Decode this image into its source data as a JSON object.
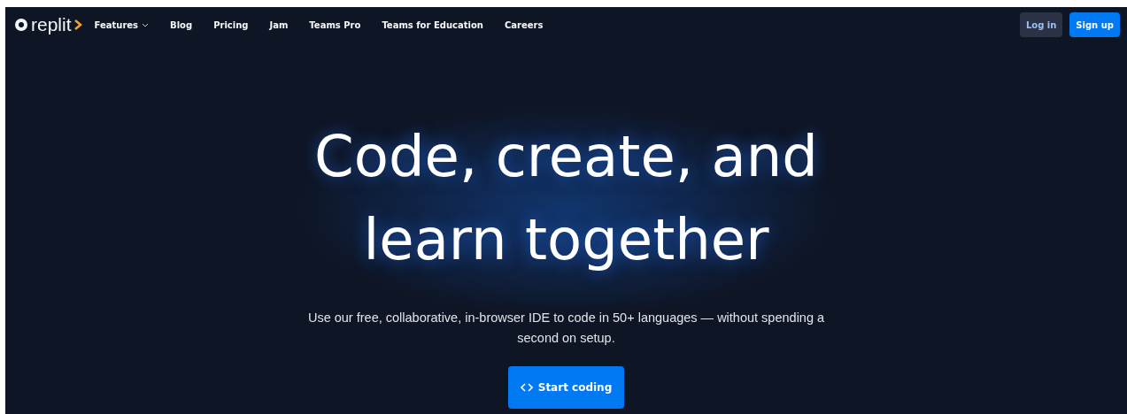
{
  "nav": {
    "logo": "replit",
    "links": [
      {
        "label": "Features",
        "dropdown": true
      },
      {
        "label": "Blog",
        "dropdown": false
      },
      {
        "label": "Pricing",
        "dropdown": false
      },
      {
        "label": "Jam",
        "dropdown": false
      },
      {
        "label": "Teams Pro",
        "dropdown": false
      },
      {
        "label": "Teams for Education",
        "dropdown": false
      },
      {
        "label": "Careers",
        "dropdown": false
      }
    ],
    "login": "Log in",
    "signup": "Sign up"
  },
  "hero": {
    "headline_lines": [
      "Code, create, and",
      "learn together"
    ],
    "subtitle": "Use our free, collaborative, in-browser IDE to code in 50+ languages — without spending a second on setup.",
    "cta": "Start coding"
  }
}
